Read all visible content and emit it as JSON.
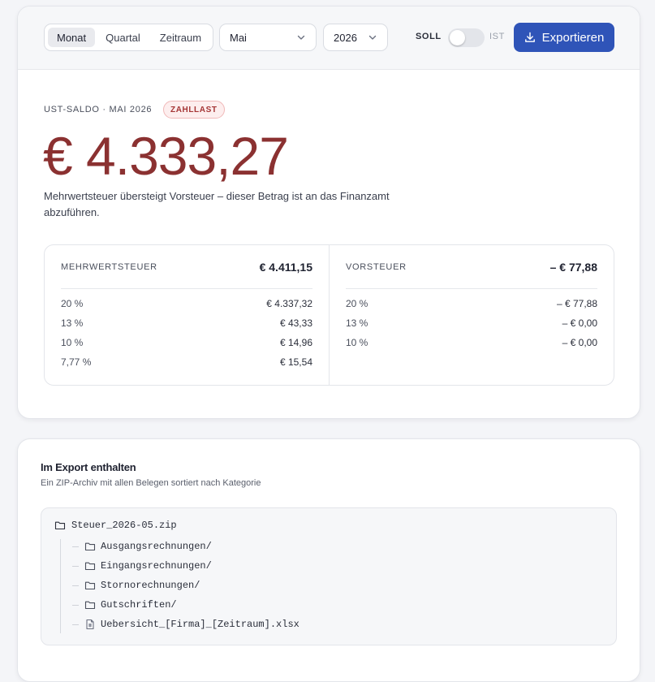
{
  "toolbar": {
    "segments": [
      "Monat",
      "Quartal",
      "Zeitraum"
    ],
    "active_segment": "Monat",
    "month": "Mai",
    "year": "2026",
    "soll_label": "SOLL",
    "ist_label": "IST",
    "export_label": "Exportieren"
  },
  "summary": {
    "kicker": "UST-SALDO · MAI 2026",
    "badge": "ZAHLLAST",
    "amount": "€ 4.333,27",
    "description": "Mehrwertsteuer übersteigt Vorsteuer – dieser Betrag ist an das Finanzamt abzuführen."
  },
  "mwst": {
    "title": "MEHRWERTSTEUER",
    "total": "€ 4.411,15",
    "rows": [
      {
        "rate": "20 %",
        "value": "€ 4.337,32"
      },
      {
        "rate": "13 %",
        "value": "€ 43,33"
      },
      {
        "rate": "10 %",
        "value": "€ 14,96"
      },
      {
        "rate": "7,77 %",
        "value": "€ 15,54"
      }
    ]
  },
  "vorsteuer": {
    "title": "VORSTEUER",
    "total": "– € 77,88",
    "rows": [
      {
        "rate": "20 %",
        "value": "– € 77,88"
      },
      {
        "rate": "13 %",
        "value": "– € 0,00"
      },
      {
        "rate": "10 %",
        "value": "– € 0,00"
      }
    ]
  },
  "export": {
    "title": "Im Export enthalten",
    "subtitle": "Ein ZIP-Archiv mit allen Belegen sortiert nach Kategorie",
    "root": "Steuer_2026-05.zip",
    "items": [
      {
        "name": "Ausgangsrechnungen/",
        "icon": "folder-icon"
      },
      {
        "name": "Eingangsrechnungen/",
        "icon": "folder-icon"
      },
      {
        "name": "Stornorechnungen/",
        "icon": "folder-icon"
      },
      {
        "name": "Gutschriften/",
        "icon": "folder-icon"
      },
      {
        "name": "Uebersicht_[Firma]_[Zeitraum].xlsx",
        "icon": "spreadsheet-file-icon"
      }
    ]
  },
  "colors": {
    "accent": "#2f54b8",
    "amount": "#8b3131",
    "badge_text": "#a53535",
    "badge_bg": "#fdeeee"
  }
}
